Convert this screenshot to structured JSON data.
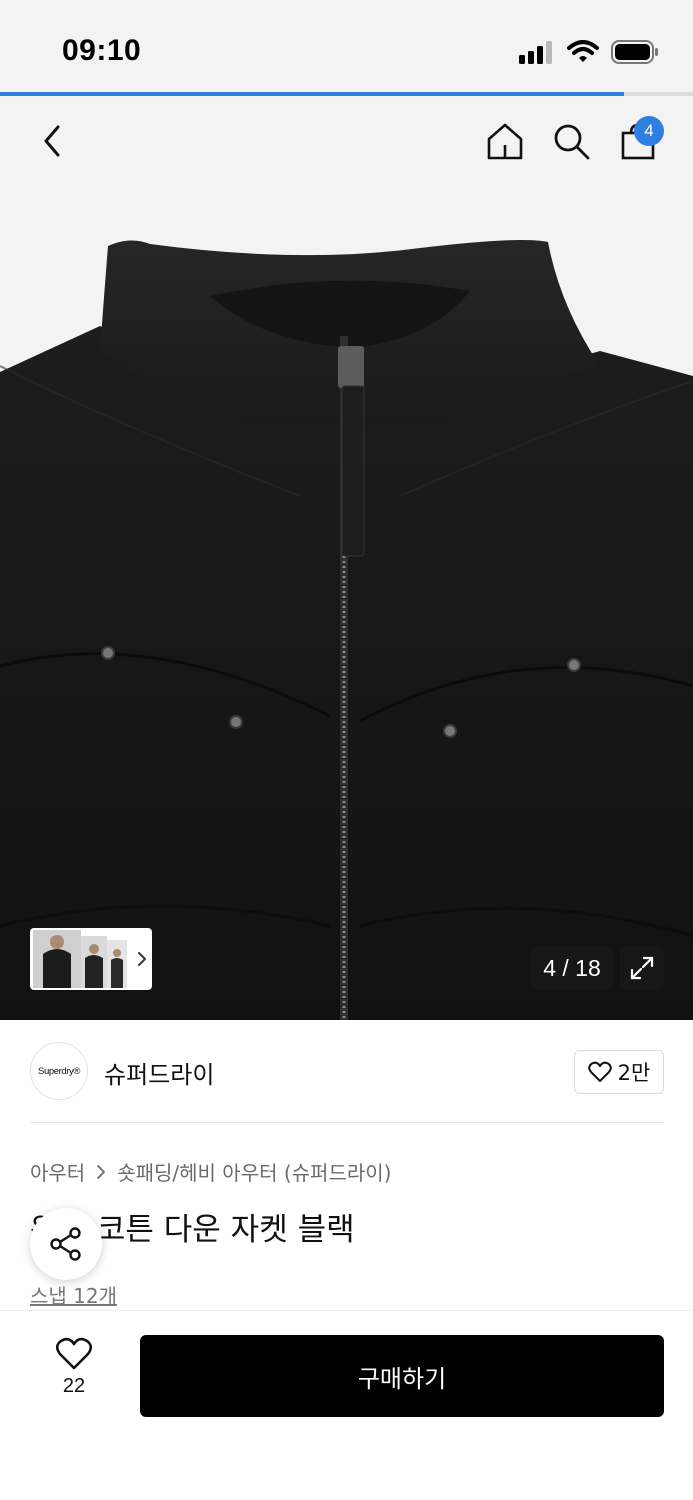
{
  "status_bar": {
    "time": "09:10",
    "icons": [
      "signal-icon",
      "wifi-icon",
      "battery-icon"
    ]
  },
  "gallery_progress": 0.9,
  "nav": {
    "icons": [
      "back-icon",
      "home-icon",
      "search-icon",
      "cart-icon"
    ],
    "cart_badge": "4"
  },
  "gallery": {
    "counter": "4 / 18",
    "expand_icon": "expand-icon",
    "thumb_chevron_icon": "chevron-right-icon"
  },
  "brand": {
    "logo_text": "Superdry®",
    "name": "슈퍼드라이",
    "likes": "2만"
  },
  "breadcrumb": {
    "category": "아우터",
    "subcategory": "숏패딩/헤비 아우터 (슈퍼드라이)"
  },
  "product": {
    "title": "워크 코튼 다운 자켓 블랙",
    "snap_link": "스냅 12개"
  },
  "bottom_bar": {
    "wish_count": "22",
    "buy_label": "구매하기"
  },
  "colors": {
    "accent": "#2f7fe0",
    "buy_button": "#000000",
    "background": "#f3f3f3"
  }
}
